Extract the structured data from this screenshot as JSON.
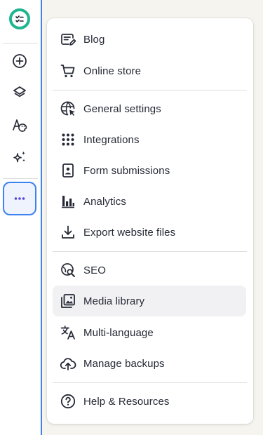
{
  "rail": {
    "items": [
      {
        "icon": "add-circle-icon"
      },
      {
        "icon": "layers-icon"
      },
      {
        "icon": "theme-font-palette-icon"
      },
      {
        "icon": "sparkles-ai-icon"
      },
      {
        "icon": "more-dots-icon"
      }
    ],
    "accent": "#3d82f0",
    "logo_color": "#1fb58f"
  },
  "menu": {
    "groups": [
      {
        "items": [
          {
            "label": "Blog",
            "icon": "blog-edit-icon"
          },
          {
            "label": "Online store",
            "icon": "shopping-cart-icon"
          }
        ]
      },
      {
        "items": [
          {
            "label": "General settings",
            "icon": "globe-cursor-icon"
          },
          {
            "label": "Integrations",
            "icon": "grid-dots-icon"
          },
          {
            "label": "Form submissions",
            "icon": "form-contact-icon"
          },
          {
            "label": "Analytics",
            "icon": "bar-chart-icon"
          },
          {
            "label": "Export website files",
            "icon": "download-icon"
          }
        ]
      },
      {
        "items": [
          {
            "label": "SEO",
            "icon": "seo-search-icon"
          },
          {
            "label": "Media library",
            "icon": "media-images-icon",
            "active": true
          },
          {
            "label": "Multi-language",
            "icon": "translate-icon"
          },
          {
            "label": "Manage backups",
            "icon": "cloud-backup-icon"
          }
        ]
      },
      {
        "items": [
          {
            "label": "Help & Resources",
            "icon": "help-circle-icon"
          }
        ]
      }
    ]
  }
}
